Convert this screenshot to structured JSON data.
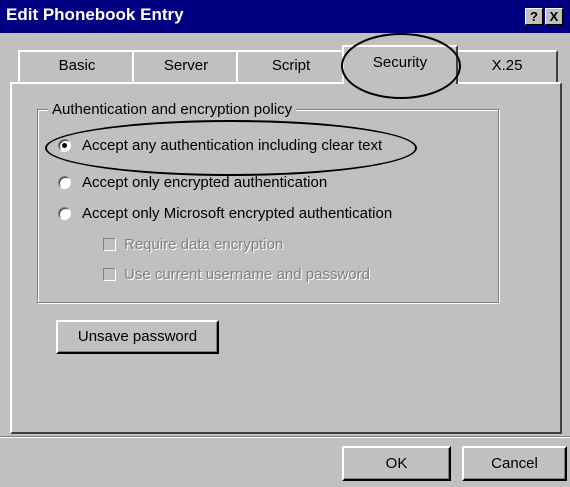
{
  "window": {
    "title": "Edit Phonebook Entry",
    "help_button": "?",
    "close_button": "X"
  },
  "tabs": [
    {
      "label": "Basic"
    },
    {
      "label": "Server"
    },
    {
      "label": "Script"
    },
    {
      "label": "Security",
      "selected": true
    },
    {
      "label": "X.25"
    }
  ],
  "security": {
    "group_label": "Authentication and encryption policy",
    "options": [
      {
        "label": "Accept any authentication including clear text",
        "selected": true
      },
      {
        "label": "Accept only encrypted authentication",
        "selected": false
      },
      {
        "label": "Accept only Microsoft encrypted authentication",
        "selected": false
      }
    ],
    "checkboxes": [
      {
        "label": "Require data encryption",
        "checked": false,
        "enabled": false
      },
      {
        "label": "Use current username and password",
        "checked": false,
        "enabled": false
      }
    ],
    "unsave_button": "Unsave password"
  },
  "dialog_buttons": {
    "ok": "OK",
    "cancel": "Cancel"
  },
  "colors": {
    "title_bar": "#000080",
    "face": "#c0c0c0"
  }
}
